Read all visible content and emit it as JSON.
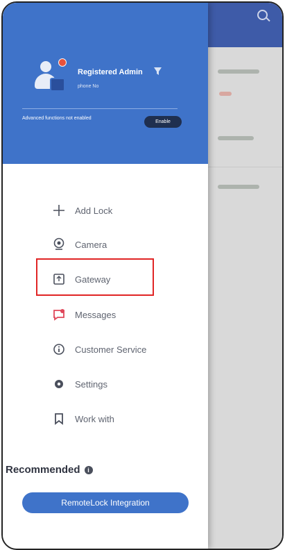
{
  "header": {
    "admin_name": "Registered Admin",
    "phone": "phone No",
    "advanced_text": "Advanced functions not enabled",
    "enable_label": "Enable"
  },
  "menu": {
    "items": [
      {
        "label": "Add Lock",
        "icon": "plus-icon"
      },
      {
        "label": "Camera",
        "icon": "camera-icon"
      },
      {
        "label": "Gateway",
        "icon": "gateway-icon"
      },
      {
        "label": "Messages",
        "icon": "message-icon"
      },
      {
        "label": "Customer Service",
        "icon": "info-circle-icon"
      },
      {
        "label": "Settings",
        "icon": "gear-icon"
      },
      {
        "label": "Work with",
        "icon": "bookmark-icon"
      }
    ]
  },
  "recommended": {
    "title": "Recommended",
    "button_label": "RemoteLock Integration"
  },
  "colors": {
    "header_blue": "#3f73c9",
    "highlight_red": "#e02424",
    "messages_red": "#e0475a"
  }
}
